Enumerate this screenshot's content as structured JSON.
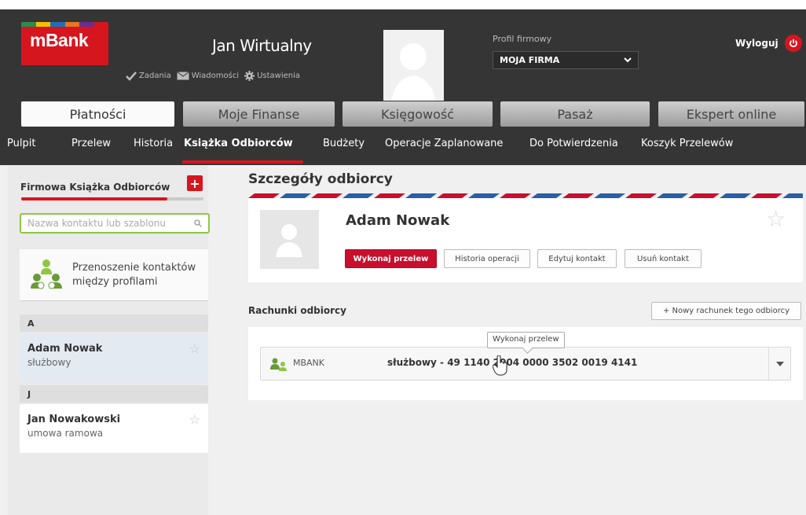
{
  "brand": {
    "logo_text": "mBank",
    "colors": {
      "accent": "#d7151f",
      "header_bg": "#353535",
      "green": "#8fc644"
    }
  },
  "header": {
    "user_name": "Jan Wirtualny",
    "links": [
      {
        "label": "Zadania",
        "icon": "check-icon"
      },
      {
        "label": "Wiadomości",
        "icon": "envelope-icon"
      },
      {
        "label": "Ustawienia",
        "icon": "gear-icon"
      }
    ],
    "profile_label": "Profil firmowy",
    "profile_value": "MOJA FIRMA",
    "logout_label": "Wyloguj"
  },
  "main_tabs": [
    {
      "label": "Płatności",
      "active": true
    },
    {
      "label": "Moje Finanse",
      "active": false
    },
    {
      "label": "Księgowość",
      "active": false
    },
    {
      "label": "Pasaż",
      "active": false
    },
    {
      "label": "Ekspert online",
      "active": false
    }
  ],
  "sub_nav": [
    {
      "label": "Pulpit",
      "active": false
    },
    {
      "label": "Przelew",
      "active": false
    },
    {
      "label": "Historia",
      "active": false
    },
    {
      "label": "Książka Odbiorców",
      "active": true
    },
    {
      "label": "Budżety",
      "active": false
    },
    {
      "label": "Operacje Zaplanowane",
      "active": false
    },
    {
      "label": "Do Potwierdzenia",
      "active": false
    },
    {
      "label": "Koszyk Przelewów",
      "active": false
    }
  ],
  "sidebar": {
    "title": "Firmowa Książka Odbiorców",
    "add_label": "+",
    "progress": 0.8,
    "search_placeholder": "Nazwa kontaktu lub szablonu",
    "transfer_line1": "Przenoszenie kontaktów",
    "transfer_line2": "między profilami",
    "groups": [
      {
        "letter": "A",
        "contacts": [
          {
            "name": "Adam Nowak",
            "type": "służbowy",
            "selected": true
          }
        ]
      },
      {
        "letter": "J",
        "contacts": [
          {
            "name": "Jan Nowakowski",
            "type": "umowa ramowa",
            "selected": false
          }
        ]
      }
    ]
  },
  "detail": {
    "title": "Szczegóły odbiorcy",
    "contact_name": "Adam Nowak",
    "buttons": {
      "transfer": "Wykonaj przelew",
      "history": "Historia operacji",
      "edit": "Edytuj kontakt",
      "delete": "Usuń kontakt"
    },
    "accounts_title": "Rachunki odbiorcy",
    "new_account_label": "+ Nowy rachunek tego odbiorcy",
    "account": {
      "bank": "MBANK",
      "number": "służbowy  - 49 1140 2004 0000 3502 0019 4141"
    },
    "tooltip": "Wykonaj przelew"
  }
}
